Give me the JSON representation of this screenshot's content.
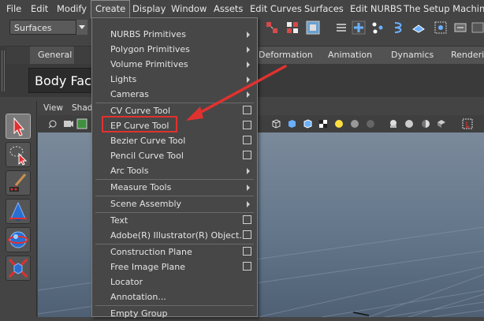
{
  "menubar": {
    "items": [
      "File",
      "Edit",
      "Modify",
      "Create",
      "Display",
      "Window",
      "Assets",
      "Edit Curves",
      "Surfaces",
      "Edit NURBS",
      "The Setup Machine"
    ]
  },
  "statusline": {
    "mode": "Surfaces"
  },
  "shelf": {
    "tabs": [
      "General",
      "Deformation",
      "Animation",
      "Dynamics",
      "Rendering"
    ],
    "body_face_label": "Body Face"
  },
  "viewport": {
    "menu": [
      "View",
      "Shad"
    ]
  },
  "create_menu": {
    "items": [
      {
        "label": "NURBS Primitives",
        "kind": "submenu"
      },
      {
        "label": "Polygon Primitives",
        "kind": "submenu"
      },
      {
        "label": "Volume Primitives",
        "kind": "submenu"
      },
      {
        "label": "Lights",
        "kind": "submenu"
      },
      {
        "label": "Cameras",
        "kind": "submenu"
      },
      {
        "label": "CV Curve Tool",
        "kind": "option"
      },
      {
        "label": "EP Curve Tool",
        "kind": "option"
      },
      {
        "label": "Bezier Curve Tool",
        "kind": "option"
      },
      {
        "label": "Pencil Curve Tool",
        "kind": "option"
      },
      {
        "label": "Arc Tools",
        "kind": "submenu"
      },
      {
        "label": "Measure Tools",
        "kind": "submenu"
      },
      {
        "label": "Scene Assembly",
        "kind": "submenu"
      },
      {
        "label": "Text",
        "kind": "option"
      },
      {
        "label": "Adobe(R) Illustrator(R) Object...",
        "kind": "option"
      },
      {
        "label": "Construction Plane",
        "kind": "option"
      },
      {
        "label": "Free Image Plane",
        "kind": "option"
      },
      {
        "label": "Locator",
        "kind": "plain"
      },
      {
        "label": "Annotation...",
        "kind": "plain"
      },
      {
        "label": "Empty Group",
        "kind": "plain"
      }
    ],
    "highlighted_item": "EP Curve Tool"
  },
  "colors": {
    "annotation_red": "#e0322f",
    "menu_bg": "#474747",
    "viewport_top": "#7a8a9b"
  },
  "icons": {
    "toolbox": [
      "select-arrow-icon",
      "lasso-select-icon",
      "paint-select-icon",
      "move-cone-icon",
      "rotate-sphere-icon",
      "scale-cube-icon"
    ]
  }
}
